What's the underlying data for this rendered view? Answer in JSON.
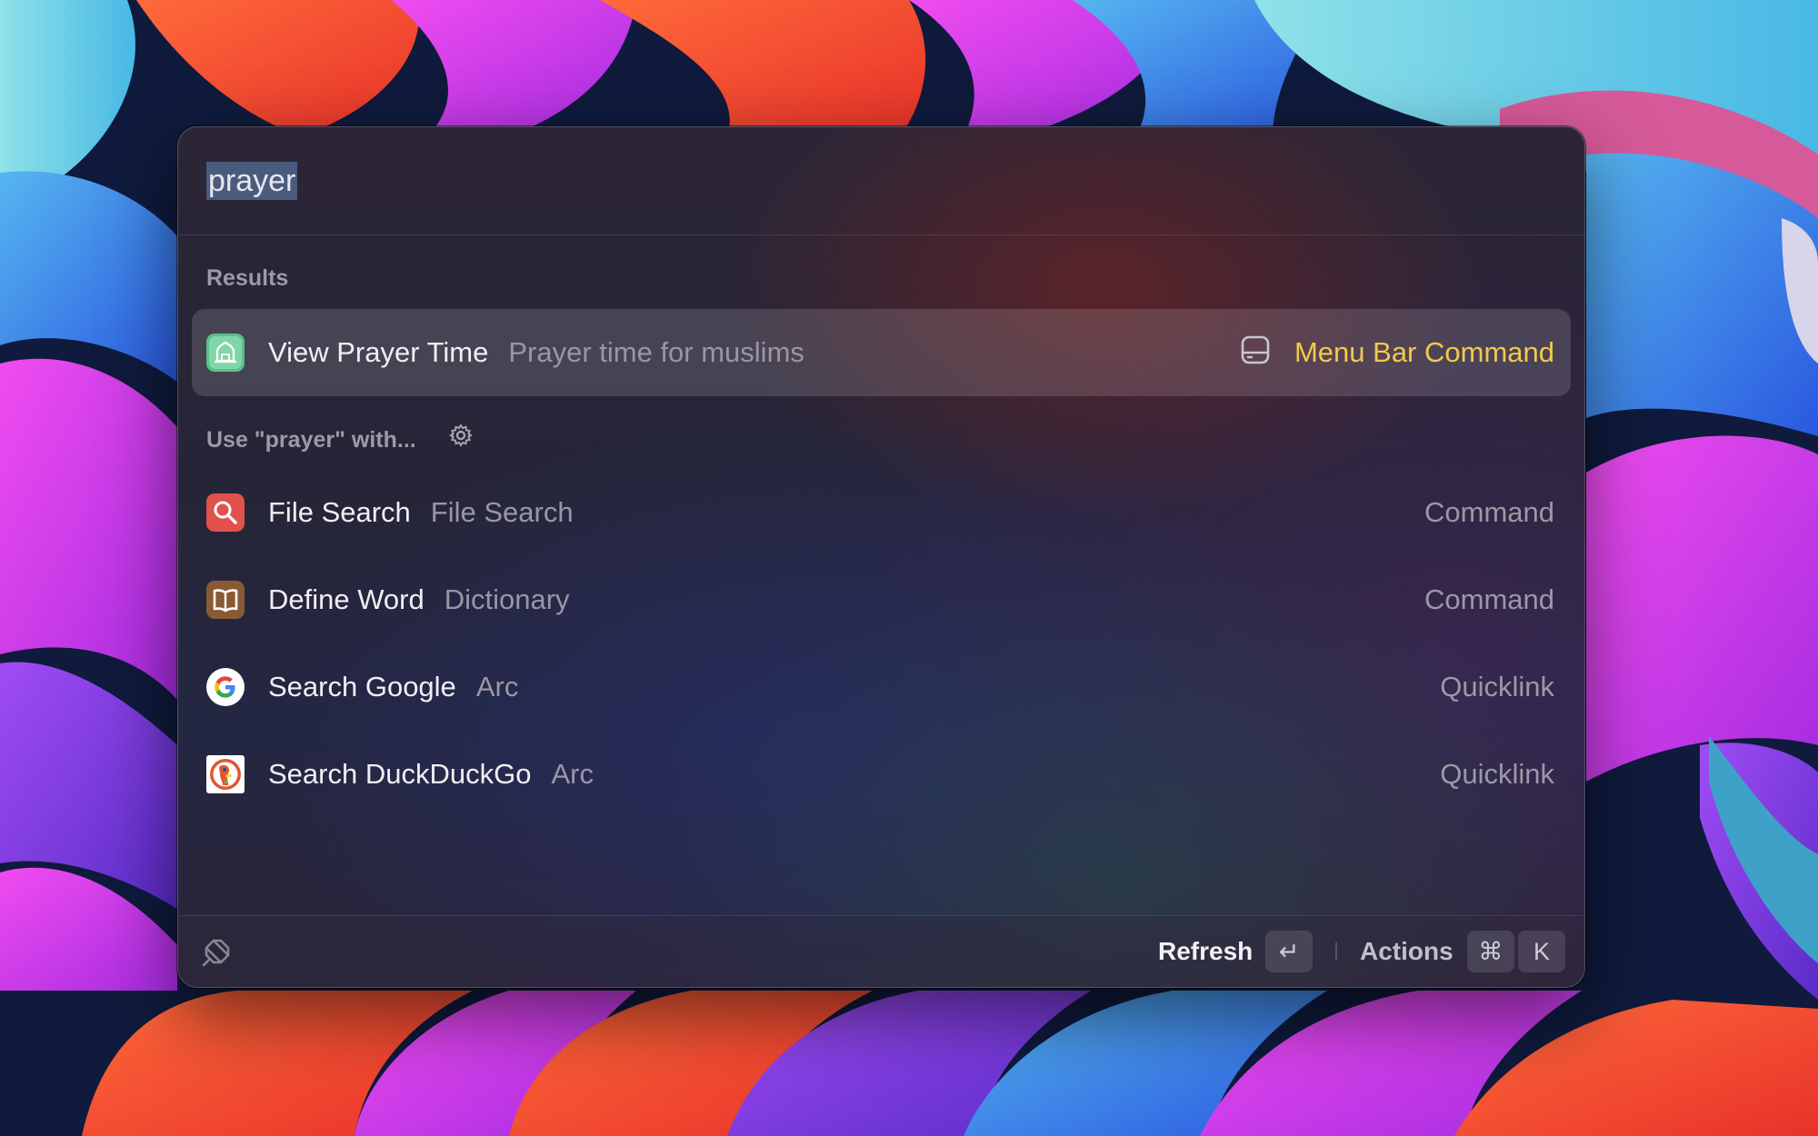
{
  "search": {
    "query": "prayer"
  },
  "sections": {
    "results_label": "Results",
    "fallback_label": "Use \"prayer\" with..."
  },
  "results": [
    {
      "title": "View Prayer Time",
      "subtitle": "Prayer time for muslims",
      "accessory": "Menu Bar Command",
      "icon": "mosque-icon",
      "selected": true
    }
  ],
  "fallbacks": [
    {
      "title": "File Search",
      "subtitle": "File Search",
      "accessory": "Command",
      "icon": "magnifier-icon"
    },
    {
      "title": "Define Word",
      "subtitle": "Dictionary",
      "accessory": "Command",
      "icon": "book-icon"
    },
    {
      "title": "Search Google",
      "subtitle": "Arc",
      "accessory": "Quicklink",
      "icon": "google-icon"
    },
    {
      "title": "Search DuckDuckGo",
      "subtitle": "Arc",
      "accessory": "Quicklink",
      "icon": "duckduckgo-icon"
    }
  ],
  "footer": {
    "primary_action": "Refresh",
    "primary_key": "↵",
    "secondary_action": "Actions",
    "secondary_keys": [
      "⌘",
      "K"
    ]
  },
  "colors": {
    "accent": "#f2c94c",
    "selection": "#4a5b7d",
    "file_search_icon": "#e0524b",
    "dictionary_icon": "#8a5a35",
    "prayer_icon": "#5bbf8a"
  }
}
